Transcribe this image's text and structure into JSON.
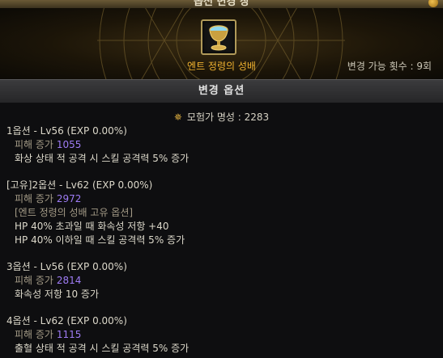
{
  "window": {
    "title": "옵션 변경 창"
  },
  "item": {
    "name": "엔트 정령의 성배",
    "change_count": "변경 가능 횟수 : 9회"
  },
  "section": {
    "title": "변경 옵션"
  },
  "fame": {
    "label": "모험가 명성 : 2283"
  },
  "options": [
    {
      "header": "1옵션 - Lv56 (EXP 0.00%)",
      "damage_label": "피해 증가",
      "damage_value": "1055",
      "effects": [
        "화상 상태 적 공격 시 스킬 공격력 5% 증가"
      ]
    },
    {
      "header": "[고유]2옵션 - Lv62 (EXP 0.00%)",
      "damage_label": "피해 증가",
      "damage_value": "2972",
      "unique": "[엔트 정령의 성배 고유 옵션]",
      "effects": [
        "HP 40% 초과일 때 화속성 저항 +40",
        "HP 40% 이하일 때 스킬 공격력 5% 증가"
      ]
    },
    {
      "header": "3옵션 - Lv56 (EXP 0.00%)",
      "damage_label": "피해 증가",
      "damage_value": "2814",
      "effects": [
        "화속성 저항 10 증가"
      ]
    },
    {
      "header": "4옵션 - Lv62 (EXP 0.00%)",
      "damage_label": "피해 증가",
      "damage_value": "1115",
      "effects": [
        "출혈 상태 적 공격 시 스킬 공격력 5% 증가"
      ]
    }
  ]
}
